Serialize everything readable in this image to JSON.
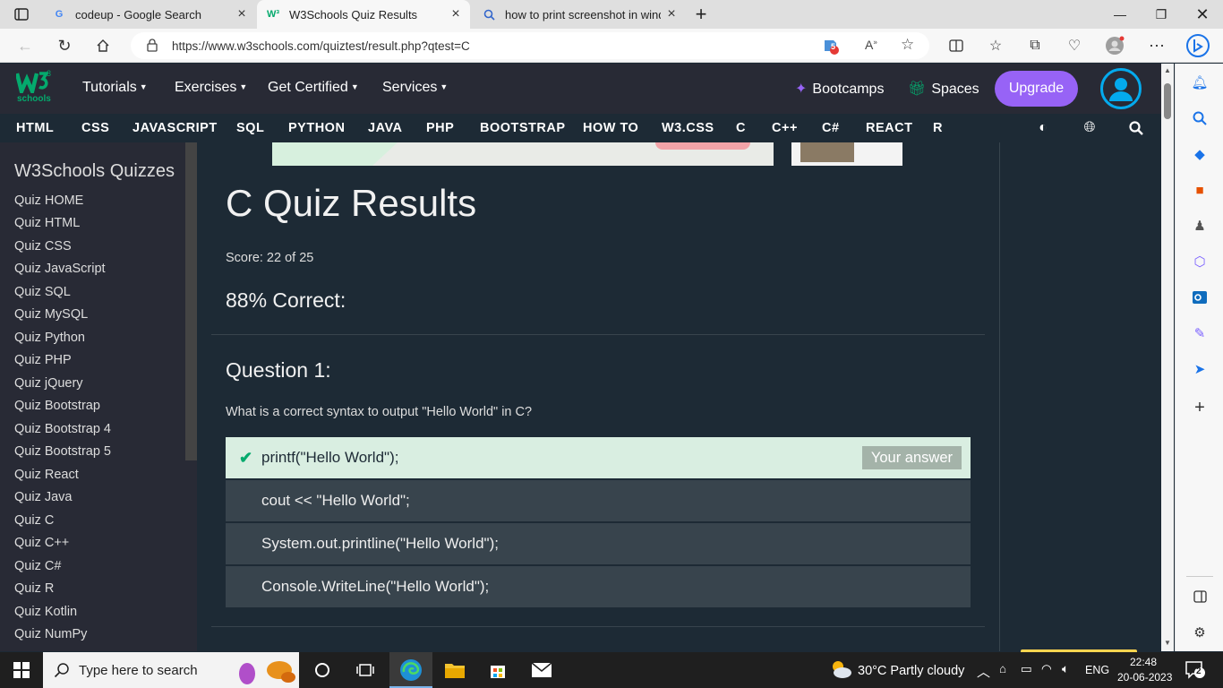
{
  "browser": {
    "tabs": [
      {
        "title": "codeup - Google Search",
        "active": false
      },
      {
        "title": "W3Schools Quiz Results",
        "active": true
      },
      {
        "title": "how to print screenshot in windo",
        "active": false
      }
    ],
    "url": "https://www.w3schools.com/quiztest/result.php?qtest=C",
    "extension_badge": "5"
  },
  "site": {
    "logo_text": "schools",
    "logo_sup": "3",
    "menu": [
      "Tutorials",
      "Exercises",
      "Get Certified",
      "Services"
    ],
    "bootcamps": "Bootcamps",
    "spaces": "Spaces",
    "upgrade": "Upgrade",
    "topnav": [
      "HTML",
      "CSS",
      "JAVASCRIPT",
      "SQL",
      "PYTHON",
      "JAVA",
      "PHP",
      "BOOTSTRAP",
      "HOW TO",
      "W3.CSS",
      "C",
      "C++",
      "C#",
      "REACT",
      "R"
    ]
  },
  "sidebar": {
    "title": "W3Schools Quizzes",
    "links": [
      "Quiz HOME",
      "Quiz HTML",
      "Quiz CSS",
      "Quiz JavaScript",
      "Quiz SQL",
      "Quiz MySQL",
      "Quiz Python",
      "Quiz PHP",
      "Quiz jQuery",
      "Quiz Bootstrap",
      "Quiz Bootstrap 4",
      "Quiz Bootstrap 5",
      "Quiz React",
      "Quiz Java",
      "Quiz C",
      "Quiz C++",
      "Quiz C#",
      "Quiz R",
      "Quiz Kotlin",
      "Quiz NumPy"
    ]
  },
  "main": {
    "title": "C Quiz Results",
    "score": "Score: 22 of 25",
    "percent": "88% Correct:",
    "question_title": "Question 1:",
    "question_text": "What is a correct syntax to output \"Hello World\" in C?",
    "answers": [
      {
        "text": "printf(\"Hello World\");",
        "correct": true
      },
      {
        "text": "cout << \"Hello World\";",
        "correct": false
      },
      {
        "text": "System.out.printline(\"Hello World\");",
        "correct": false
      },
      {
        "text": "Console.WriteLine(\"Hello World\");",
        "correct": false
      }
    ],
    "your_answer": "Your answer"
  },
  "taskbar": {
    "search_placeholder": "Type here to search",
    "weather": "30°C  Partly cloudy",
    "language": "ENG",
    "time": "22:48",
    "date": "20-06-2023",
    "notification_count": "2"
  },
  "colors": {
    "w3_green": "#04aa6d",
    "upgrade_purple": "#9763f6",
    "header_bg": "#282a35",
    "page_bg": "#1d2a35"
  }
}
